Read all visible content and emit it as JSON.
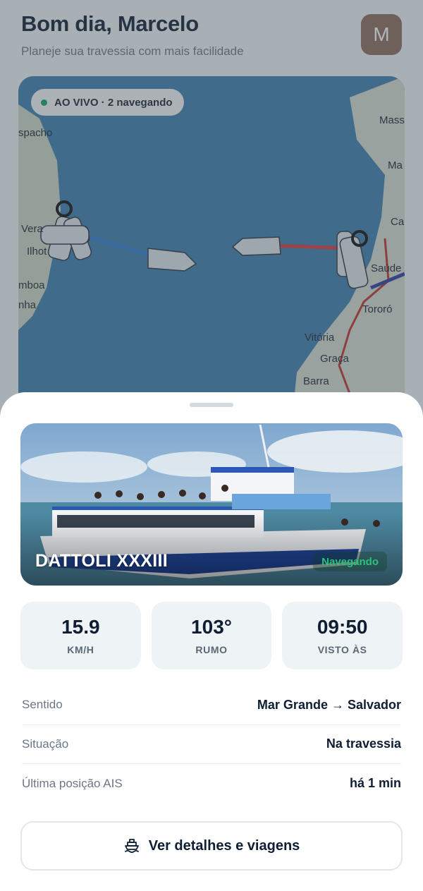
{
  "header": {
    "greeting": "Bom dia, Marcelo",
    "subtitle": "Planeje sua travessia com mais facilidade",
    "avatar_initial": "M"
  },
  "map": {
    "live_label": "AO VIVO · 2 navegando",
    "places": [
      "spacho",
      "Vera",
      "Ilhot",
      "mboa",
      "nha",
      "Mass",
      "Ma",
      "Ca",
      "Saúde",
      "Tororó",
      "Vitória",
      "Graça",
      "Barra"
    ]
  },
  "vessel": {
    "name": "DATTOLI XXXIII",
    "status": "Navegando",
    "stats": [
      {
        "value": "15.9",
        "label": "KM/H"
      },
      {
        "value": "103°",
        "label": "RUMO"
      },
      {
        "value": "09:50",
        "label": "VISTO ÀS"
      }
    ],
    "details": [
      {
        "label": "Sentido",
        "value": "Mar Grande → Salvador"
      },
      {
        "label": "Situação",
        "value": "Na travessia"
      },
      {
        "label": "Última posição AIS",
        "value": "há 1 min"
      }
    ],
    "button_label": "Ver detalhes e viagens"
  },
  "colors": {
    "live": "#12a36a",
    "status": "#2dc27a",
    "route_west": "#2f7fd6",
    "route_east": "#d93a3a"
  },
  "icons": [
    "ferry-icon"
  ]
}
